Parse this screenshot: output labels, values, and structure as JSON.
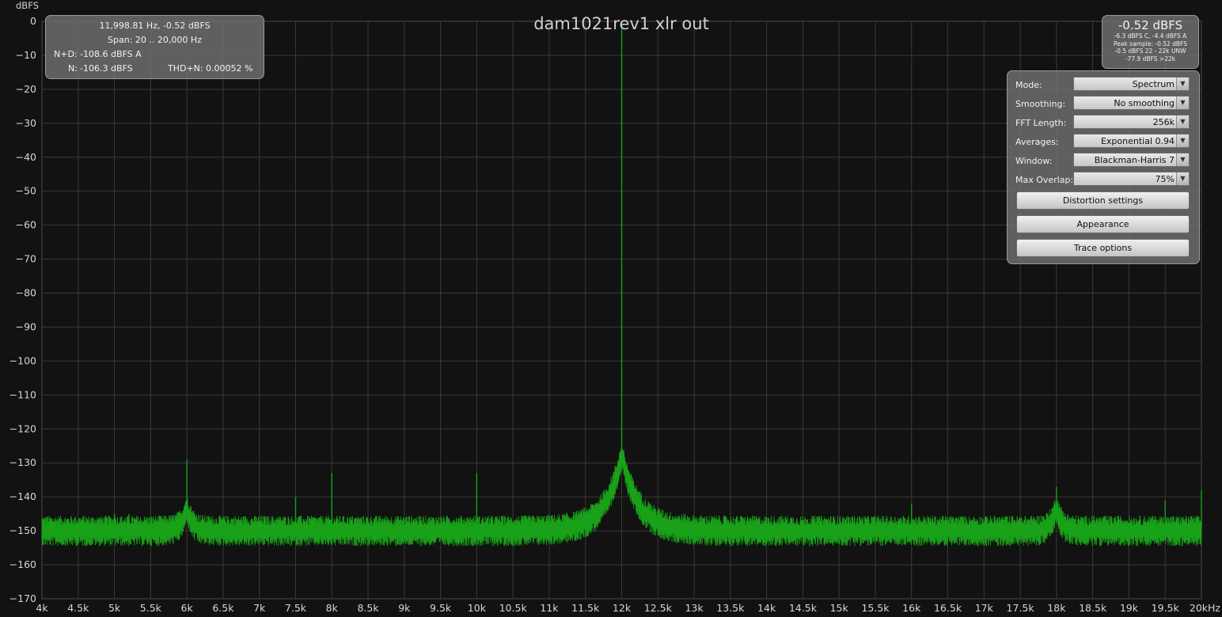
{
  "title": "dam1021rev1 xlr out",
  "readout": {
    "cursor": "11,998.81 Hz, -0.52 dBFS",
    "span": "Span: 20 .. 20,000 Hz",
    "nd_label": "N+D:",
    "nd_value": "-108.6 dBFS A",
    "n_label": "N:",
    "n_value": "-106.3 dBFS",
    "thdn_label": "THD+N:",
    "thdn_value": "0.00052 %"
  },
  "level": {
    "main": "-0.52 dBFS",
    "lines": [
      "-6.3 dBFS C, -4.4 dBFS A",
      "Peak sample: -0.52 dBFS",
      "-0.5 dBFS 22 - 22k UNW",
      "-77.9 dBFS >22k"
    ]
  },
  "settings": {
    "mode": {
      "label": "Mode:",
      "value": "Spectrum"
    },
    "smoothing": {
      "label": "Smoothing:",
      "value": "No  smoothing"
    },
    "fft": {
      "label": "FFT Length:",
      "value": "256k"
    },
    "averages": {
      "label": "Averages:",
      "value": "Exponential 0.94"
    },
    "window": {
      "label": "Window:",
      "value": "Blackman-Harris 7"
    },
    "overlap": {
      "label": "Max Overlap:",
      "value": "75%"
    },
    "buttons": {
      "distortion": "Distortion settings",
      "appearance": "Appearance",
      "trace": "Trace options"
    }
  },
  "chart_data": {
    "type": "line",
    "ylabel": "dBFS",
    "ylim": [
      -170,
      0
    ],
    "xlim": [
      4000,
      20000
    ],
    "x_ticks": [
      4000,
      4500,
      5000,
      5500,
      6000,
      6500,
      7000,
      7500,
      8000,
      8500,
      9000,
      9500,
      10000,
      10500,
      11000,
      11500,
      12000,
      12500,
      13000,
      13500,
      14000,
      14500,
      15000,
      15500,
      16000,
      16500,
      17000,
      17500,
      18000,
      18500,
      19000,
      19500,
      20000
    ],
    "x_tick_labels": [
      "4k",
      "4.5k",
      "5k",
      "5.5k",
      "6k",
      "6.5k",
      "7k",
      "7.5k",
      "8k",
      "8.5k",
      "9k",
      "9.5k",
      "10k",
      "10.5k",
      "11k",
      "11.5k",
      "12k",
      "12.5k",
      "13k",
      "13.5k",
      "14k",
      "14.5k",
      "15k",
      "15.5k",
      "16k",
      "16.5k",
      "17k",
      "17.5k",
      "18k",
      "18.5k",
      "19k",
      "19.5k",
      "20kHz"
    ],
    "y_ticks": [
      0,
      -10,
      -20,
      -30,
      -40,
      -50,
      -60,
      -70,
      -80,
      -90,
      -100,
      -110,
      -120,
      -130,
      -140,
      -150,
      -160,
      -170
    ],
    "grid": true,
    "series_color": "#19a219",
    "noise_floor_dbfs": -149.5,
    "peaks": [
      {
        "x": 12000,
        "y": -0.52
      },
      {
        "x": 6000,
        "y": -129
      },
      {
        "x": 8000,
        "y": -133
      },
      {
        "x": 10000,
        "y": -133
      },
      {
        "x": 7500,
        "y": -140
      },
      {
        "x": 18000,
        "y": -137
      },
      {
        "x": 16000,
        "y": -142
      },
      {
        "x": 19500,
        "y": -141
      },
      {
        "x": 20000,
        "y": -138
      },
      {
        "x": 5000,
        "y": -145
      },
      {
        "x": 5200,
        "y": -145
      }
    ]
  }
}
